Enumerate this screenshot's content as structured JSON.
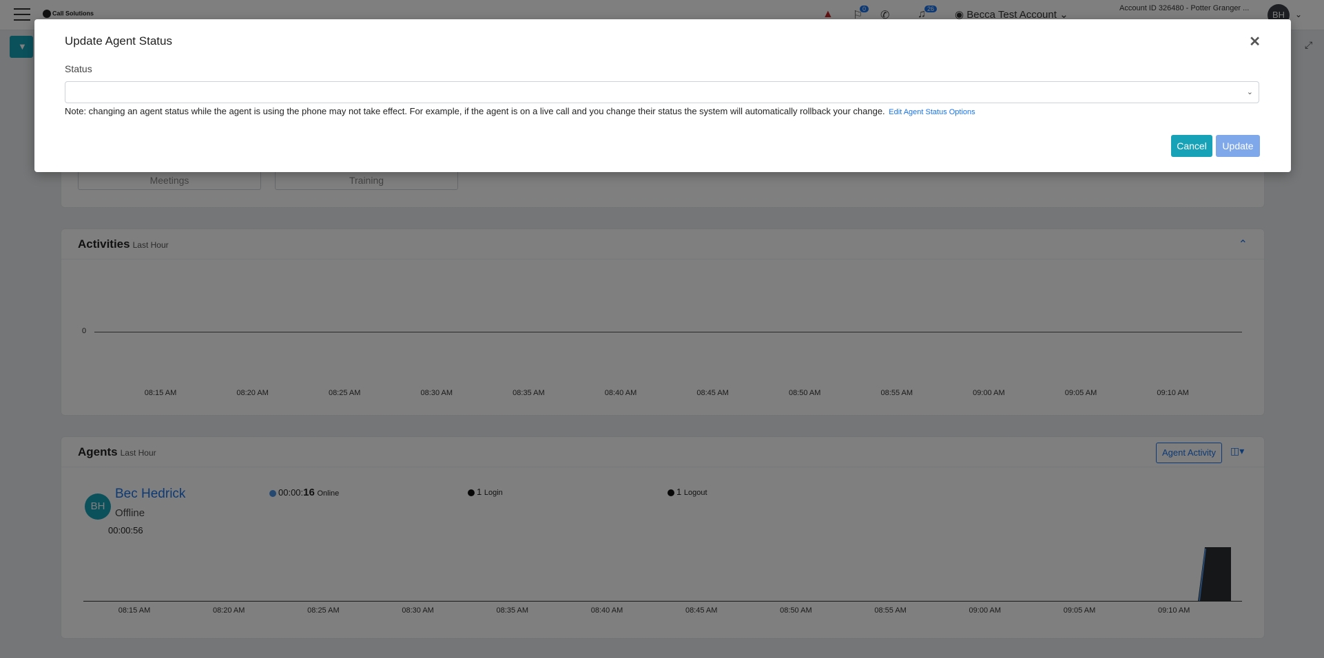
{
  "header": {
    "logo_text": "Call Solutions",
    "bookmark_badge": "0",
    "notification_badge": "26",
    "account_name": "Becca Test Account",
    "account_id_text": "Account ID 326480  -  Potter Granger ...",
    "user_initials": "BH"
  },
  "status_tiles": [
    "Meetings",
    "Training"
  ],
  "activities": {
    "title": "Activities",
    "subtitle": "Last Hour",
    "y_zero_label": "0",
    "time_ticks": [
      "08:15 AM",
      "08:20 AM",
      "08:25 AM",
      "08:30 AM",
      "08:35 AM",
      "08:40 AM",
      "08:45 AM",
      "08:50 AM",
      "08:55 AM",
      "09:00 AM",
      "09:05 AM",
      "09:10 AM"
    ]
  },
  "agents": {
    "title": "Agents",
    "subtitle": "Last Hour",
    "agent_activity_label": "Agent Activity",
    "agent": {
      "initials": "BH",
      "name": "Bec Hedrick",
      "status": "Offline",
      "duration": "00:00:56"
    },
    "legend": {
      "online_prefix": "00:00:",
      "online_seconds": "16",
      "online_label": "Online",
      "login_count": "1",
      "login_label": "Login",
      "logout_count": "1",
      "logout_label": "Logout"
    },
    "time_ticks": [
      "08:15 AM",
      "08:20 AM",
      "08:25 AM",
      "08:30 AM",
      "08:35 AM",
      "08:40 AM",
      "08:45 AM",
      "08:50 AM",
      "08:55 AM",
      "09:00 AM",
      "09:05 AM",
      "09:10 AM"
    ]
  },
  "modal": {
    "title": "Update Agent Status",
    "status_label": "Status",
    "status_value": "",
    "note": "Note: changing an agent status while the agent is using the phone may not take effect. For example, if the agent is on a live call and you change their status the system will automatically rollback your change.",
    "edit_link": "Edit Agent Status Options",
    "cancel_label": "Cancel",
    "update_label": "Update"
  },
  "colors": {
    "accent": "#1a73e8",
    "teal": "#17a2b8",
    "update_button": "#7ea8ea"
  }
}
